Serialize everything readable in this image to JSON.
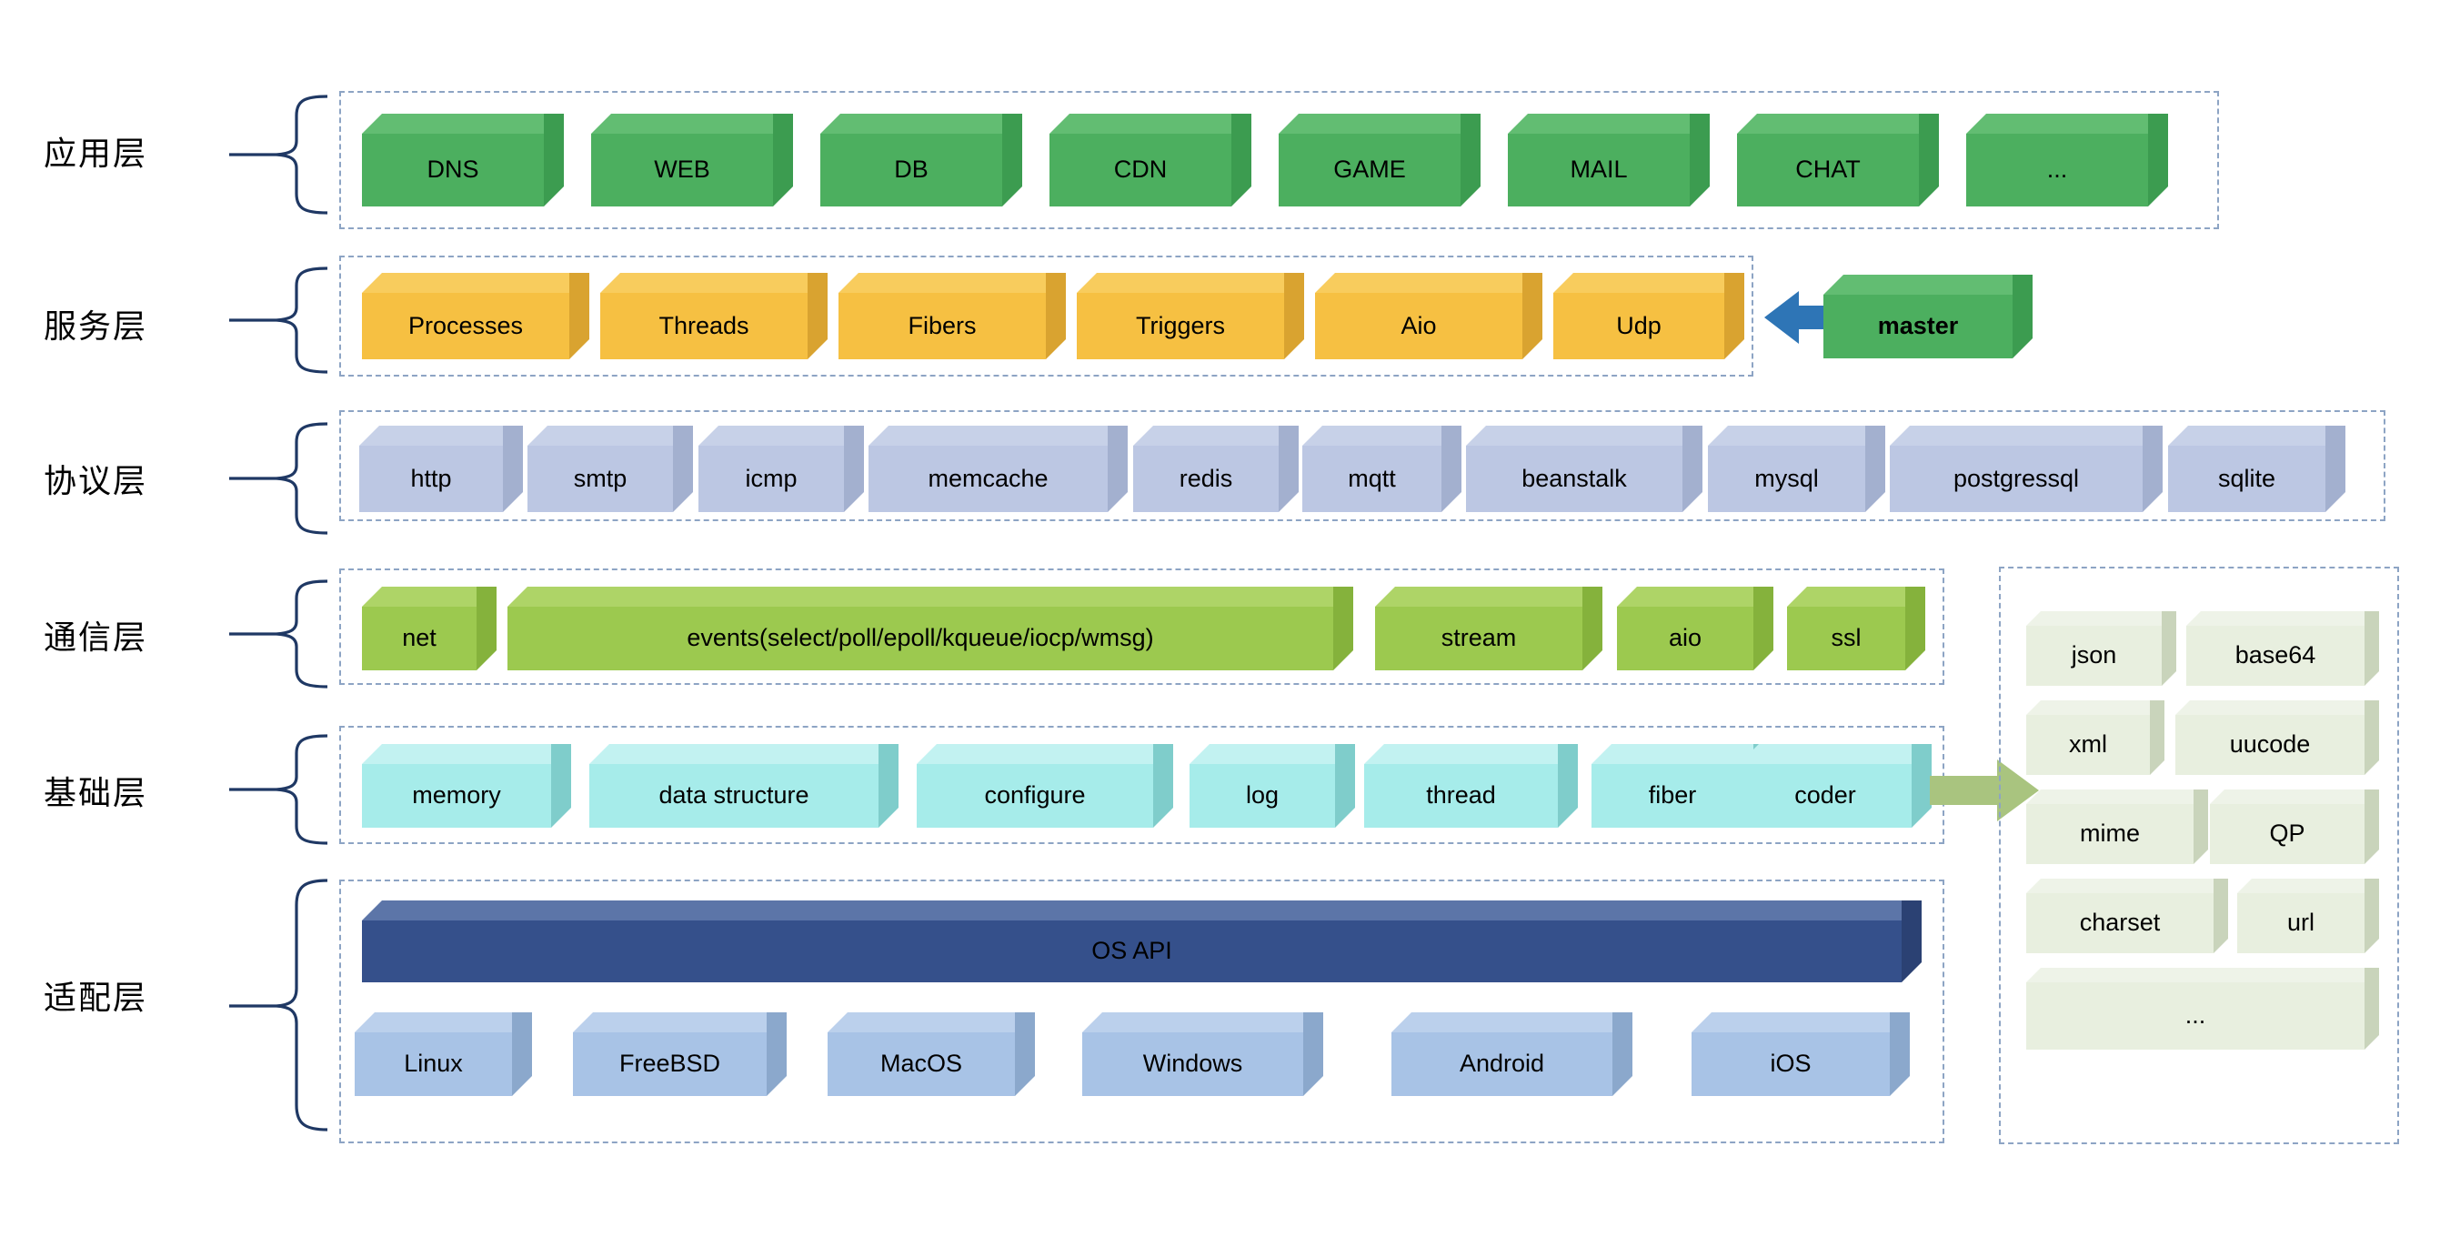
{
  "diagram": {
    "title": "acl library layered architecture",
    "colors": {
      "application": "#4caf5f",
      "service": "#f6c042",
      "protocol": "#bcc7e3",
      "communication": "#9cc94f",
      "foundation": "#a6ecea",
      "os_api": "#35508b",
      "platform": "#a8c3e6",
      "coder": "#e8efdf",
      "frame_border": "#8da4c4",
      "brace": "#1f3864",
      "arrow_blue": "#2e75b6",
      "arrow_green": "#a9c47f"
    },
    "layers": [
      {
        "id": "application",
        "label": "应用层",
        "items": [
          "DNS",
          "WEB",
          "DB",
          "CDN",
          "GAME",
          "MAIL",
          "CHAT",
          "..."
        ]
      },
      {
        "id": "service",
        "label": "服务层",
        "items": [
          "Processes",
          "Threads",
          "Fibers",
          "Triggers",
          "Aio",
          "Udp"
        ],
        "external": {
          "label": "master",
          "arrow": "left-arrow-icon"
        }
      },
      {
        "id": "protocol",
        "label": "协议层",
        "items": [
          "http",
          "smtp",
          "icmp",
          "memcache",
          "redis",
          "mqtt",
          "beanstalk",
          "mysql",
          "postgressql",
          "sqlite"
        ]
      },
      {
        "id": "communication",
        "label": "通信层",
        "items": [
          "net",
          "events(select/poll/epoll/kqueue/iocp/wmsg)",
          "stream",
          "aio",
          "ssl"
        ]
      },
      {
        "id": "foundation",
        "label": "基础层",
        "items": [
          "memory",
          "data structure",
          "configure",
          "log",
          "thread",
          "fiber",
          "coder"
        ],
        "arrow": "right-arrow-icon"
      },
      {
        "id": "adaptation",
        "label": "适配层",
        "os_api": "OS API",
        "platforms": [
          "Linux",
          "FreeBSD",
          "MacOS",
          "Windows",
          "Android",
          "iOS"
        ]
      }
    ],
    "coder_panel": {
      "items": [
        "json",
        "base64",
        "xml",
        "uucode",
        "mime",
        "QP",
        "charset",
        "url",
        "..."
      ]
    }
  }
}
